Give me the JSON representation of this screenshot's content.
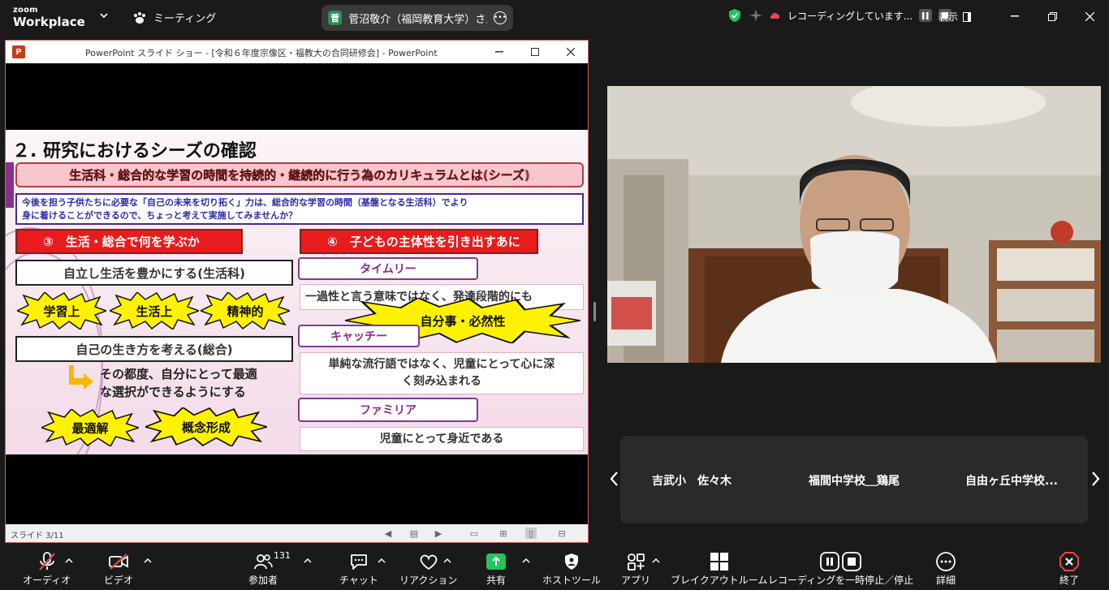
{
  "app": {
    "logo_line1": "zoom",
    "logo_line2": "Workplace",
    "meeting_label": "ミーティング",
    "host_name": "菅沼敬介（福岡教育大学）さん",
    "host_avatar": "菅",
    "recording_label": "レコーディングしています...",
    "view_label": "表示"
  },
  "ppt": {
    "window_title": "PowerPoint スライド ショー - [令和６年度宗像区・福教大の合同研修会] - PowerPoint",
    "app_icon": "P",
    "status": "スライド 3/11"
  },
  "slide": {
    "title": "２. 研究におけるシーズの確認",
    "banner": "生活科・総合的な学習の時間を持続的・継続的に行う為のカリキュラムとは(シーズ)",
    "intro_line1": "今後を担う子供たちに必要な「自己の未来を切り拓く」力は、総合的な学習の時間（基盤となる生活科）でより",
    "intro_line2": "身に着けることができるので、ちょっと考えて実施してみませんか？",
    "left_head": "③　生活・総合で何を学ぶか",
    "right_head": "④　子どもの主体性を引き出すあに",
    "box_seikatsu": "自立し生活を豊かにする(生活科)",
    "burst1": "学習上",
    "burst2": "生活上",
    "burst3": "精神的",
    "box_sogo": "自己の生き方を考える(総合)",
    "note_line1": "その都度、自分にとって最適",
    "note_line2": "な選択ができるようにする",
    "burst4": "最適解",
    "burst5": "概念形成",
    "timely": "タイムリー",
    "timely_desc": "一過性と言う意味ではなく、発達段階的にも",
    "big_burst": "自分事・必然性",
    "catchy": "キャッチー",
    "catchy_desc1": "単純な流行語ではなく、児童にとって心に深",
    "catchy_desc2": "く刻み込まれる",
    "familiar": "ファミリア",
    "familiar_desc": "児童にとって身近である"
  },
  "participants": [
    {
      "name": "吉武小　佐々木"
    },
    {
      "name": "福間中学校＿鶏尾"
    },
    {
      "name": "自由ヶ丘中学校..."
    }
  ],
  "toolbar": {
    "audio": "オーディオ",
    "video": "ビデオ",
    "participants": "参加者",
    "participants_count": "131",
    "chat": "チャット",
    "reactions": "リアクション",
    "share": "共有",
    "host_tools": "ホストツール",
    "apps": "アプリ",
    "breakout": "ブレイクアウトルーム",
    "record": "レコーディングを一時停止／停止",
    "more": "詳細",
    "end": "終了"
  },
  "colors": {
    "share_green": "#22c55e",
    "end_red": "#e5484d",
    "slide_red": "#e81c1c",
    "burst_yellow": "#fff200"
  }
}
